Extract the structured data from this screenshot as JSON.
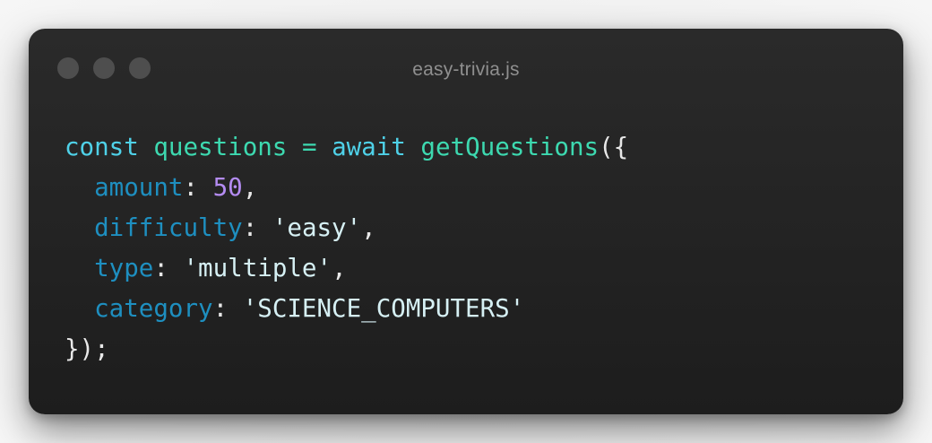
{
  "window": {
    "title": "easy-trivia.js",
    "controls": [
      "close-dot",
      "minimize-dot",
      "maximize-dot"
    ]
  },
  "code": {
    "lines": [
      {
        "tokens": [
          {
            "type": "keyword",
            "text": "const"
          },
          {
            "type": "plain",
            "text": " "
          },
          {
            "type": "variable",
            "text": "questions"
          },
          {
            "type": "plain",
            "text": " "
          },
          {
            "type": "variable",
            "text": "="
          },
          {
            "type": "plain",
            "text": " "
          },
          {
            "type": "keyword",
            "text": "await"
          },
          {
            "type": "plain",
            "text": " "
          },
          {
            "type": "function",
            "text": "getQuestions"
          },
          {
            "type": "punct",
            "text": "({"
          }
        ]
      },
      {
        "tokens": [
          {
            "type": "plain",
            "text": "  "
          },
          {
            "type": "property",
            "text": "amount"
          },
          {
            "type": "punct",
            "text": ": "
          },
          {
            "type": "number",
            "text": "50"
          },
          {
            "type": "punct",
            "text": ","
          }
        ]
      },
      {
        "tokens": [
          {
            "type": "plain",
            "text": "  "
          },
          {
            "type": "property",
            "text": "difficulty"
          },
          {
            "type": "punct",
            "text": ": "
          },
          {
            "type": "string",
            "text": "'easy'"
          },
          {
            "type": "punct",
            "text": ","
          }
        ]
      },
      {
        "tokens": [
          {
            "type": "plain",
            "text": "  "
          },
          {
            "type": "property",
            "text": "type"
          },
          {
            "type": "punct",
            "text": ": "
          },
          {
            "type": "string",
            "text": "'multiple'"
          },
          {
            "type": "punct",
            "text": ","
          }
        ]
      },
      {
        "tokens": [
          {
            "type": "plain",
            "text": "  "
          },
          {
            "type": "property",
            "text": "category"
          },
          {
            "type": "punct",
            "text": ": "
          },
          {
            "type": "string",
            "text": "'SCIENCE_COMPUTERS'"
          }
        ]
      },
      {
        "tokens": [
          {
            "type": "punct",
            "text": "});"
          }
        ]
      }
    ]
  },
  "colors": {
    "keyword": "#4fd1e8",
    "variable": "#3dd9b0",
    "function": "#3dd9b0",
    "property": "#1e8fc0",
    "number": "#b48cf2",
    "string": "#d6f0f4",
    "punct": "#e8e8e8",
    "plain": "#e8e8e8"
  }
}
